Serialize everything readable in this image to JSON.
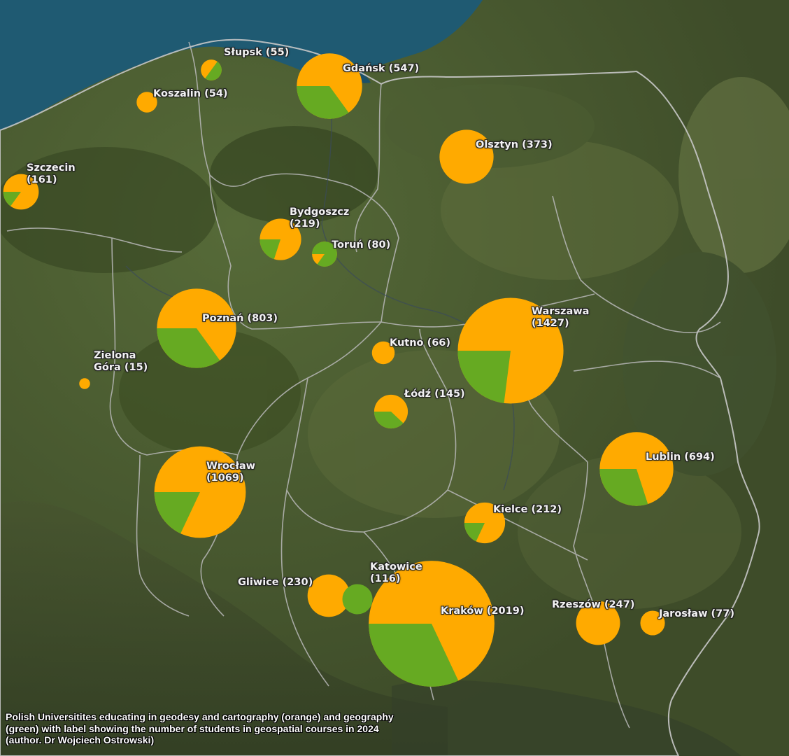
{
  "caption": "Polish Universitites educating in geodesy and cartography (orange) and geography (green) with label showing the number of students in geospatial courses in 2024 (author. Dr Wojciech Ostrowski)",
  "colors": {
    "geodesy_cartography": "#FFAA00",
    "geography": "#66AA22",
    "sea": "#1f5a72",
    "land": "#4a5a30",
    "border": "#c8c8c8"
  },
  "cities": [
    {
      "name": "Słupsk",
      "count": 55,
      "label": "Słupsk (55)",
      "green_share": 0.5
    },
    {
      "name": "Gdańsk",
      "count": 547,
      "label": "Gdańsk (547)",
      "green_share": 0.35
    },
    {
      "name": "Koszalin",
      "count": 54,
      "label": "Koszalin (54)",
      "green_share": 0
    },
    {
      "name": "Szczecin",
      "count": 161,
      "label_lines": [
        "Szczecin",
        "(161)"
      ],
      "green_share": 0.15
    },
    {
      "name": "Olsztyn",
      "count": 373,
      "label": "Olsztyn (373)",
      "green_share": 0
    },
    {
      "name": "Bydgoszcz",
      "count": 219,
      "label_lines": [
        "Bydgoszcz",
        "(219)"
      ],
      "green_share": 0.2
    },
    {
      "name": "Toruń",
      "count": 80,
      "label": "Toruń (80)",
      "green_share": 0.85
    },
    {
      "name": "Poznań",
      "count": 803,
      "label": "Poznań (803)",
      "green_share": 0.35
    },
    {
      "name": "Warszawa",
      "count": 1427,
      "label_lines": [
        "Warszawa",
        "(1427)"
      ],
      "green_share": 0.23
    },
    {
      "name": "Kutno",
      "count": 66,
      "label": "Kutno (66)",
      "green_share": 0
    },
    {
      "name": "Zielona Góra",
      "count": 15,
      "label_lines": [
        "Zielona",
        "Góra (15)"
      ],
      "green_share": 0
    },
    {
      "name": "Łódź",
      "count": 145,
      "label": "Łódź (145)",
      "green_share": 0.38
    },
    {
      "name": "Lublin",
      "count": 694,
      "label": "Lublin (694)",
      "green_share": 0.3
    },
    {
      "name": "Wrocław",
      "count": 1069,
      "label_lines": [
        "Wrocław",
        "(1069)"
      ],
      "green_share": 0.18
    },
    {
      "name": "Kielce",
      "count": 212,
      "label": "Kielce (212)",
      "green_share": 0.18
    },
    {
      "name": "Gliwice",
      "count": 230,
      "label": "Gliwice (230)",
      "green_share": 0
    },
    {
      "name": "Katowice",
      "count": 116,
      "label_lines": [
        "Katowice",
        "(116)"
      ],
      "green_share": 1
    },
    {
      "name": "Kraków",
      "count": 2019,
      "label": "Kraków (2019)",
      "green_share": 0.32
    },
    {
      "name": "Rzeszów",
      "count": 247,
      "label": "Rzeszów (247)",
      "green_share": 0
    },
    {
      "name": "Jarosław",
      "count": 77,
      "label": "Jarosław (77)",
      "green_share": 0
    }
  ]
}
